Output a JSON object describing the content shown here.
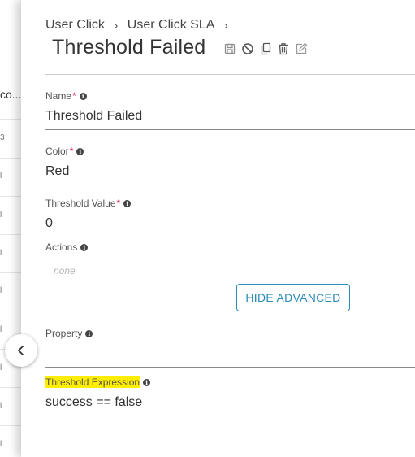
{
  "background_list": {
    "header_cell": "co...",
    "row_values": [
      "3",
      "l",
      "l",
      "l",
      "l",
      "l",
      "l",
      "l",
      "l"
    ]
  },
  "breadcrumb": {
    "items": [
      "User Click",
      "User Click SLA"
    ],
    "separator": "›"
  },
  "title": "Threshold Failed",
  "toolbar_icons": [
    "save-icon",
    "disable-icon",
    "copy-icon",
    "delete-icon",
    "edit-icon"
  ],
  "fields": {
    "name": {
      "label": "Name",
      "required": true,
      "value": "Threshold Failed"
    },
    "color": {
      "label": "Color",
      "required": true,
      "value": "Red"
    },
    "threshold_value": {
      "label": "Threshold Value",
      "required": true,
      "value": "0"
    },
    "actions": {
      "label": "Actions",
      "value": "none"
    },
    "property": {
      "label": "Property",
      "value": ""
    },
    "threshold_expression": {
      "label": "Threshold Expression",
      "value": "success == false"
    }
  },
  "required_mark": "*",
  "info_glyph": "i",
  "advanced_button": "HIDE ADVANCED",
  "colors": {
    "accent": "#2a8ab8",
    "required": "#e0245e",
    "highlight": "#ffee00"
  }
}
